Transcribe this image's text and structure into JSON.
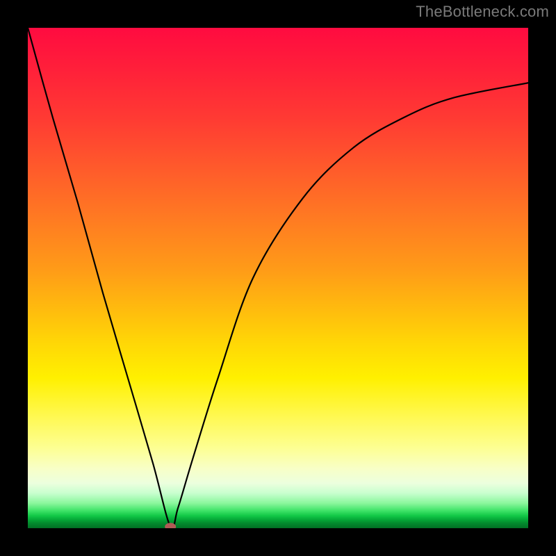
{
  "watermark": "TheBottleneck.com",
  "chart_data": {
    "type": "line",
    "title": "",
    "xlabel": "",
    "ylabel": "",
    "xlim": [
      0,
      100
    ],
    "ylim": [
      0,
      100
    ],
    "note": "Stylized bottleneck curve over a vertical red→green gradient; the minimum (optimal point) touches the green band near the bottom.",
    "series": [
      {
        "name": "bottleneck-curve",
        "x": [
          0,
          5,
          10,
          15,
          20,
          25,
          28.5,
          30,
          33,
          38,
          45,
          55,
          65,
          75,
          85,
          100
        ],
        "values": [
          100,
          82,
          65,
          47,
          30,
          13,
          0.3,
          4,
          14,
          30,
          50,
          66,
          76,
          82,
          86,
          89
        ]
      }
    ],
    "marker": {
      "x": 28.5,
      "y": 0.3,
      "label": "optimal-point"
    },
    "background_gradient": {
      "direction": "top-to-bottom",
      "stops": [
        {
          "pct": 0,
          "color": "#ff0b40"
        },
        {
          "pct": 50,
          "color": "#ff9a18"
        },
        {
          "pct": 70,
          "color": "#fff000"
        },
        {
          "pct": 95,
          "color": "#8bf79d"
        },
        {
          "pct": 100,
          "color": "#026f24"
        }
      ]
    }
  }
}
